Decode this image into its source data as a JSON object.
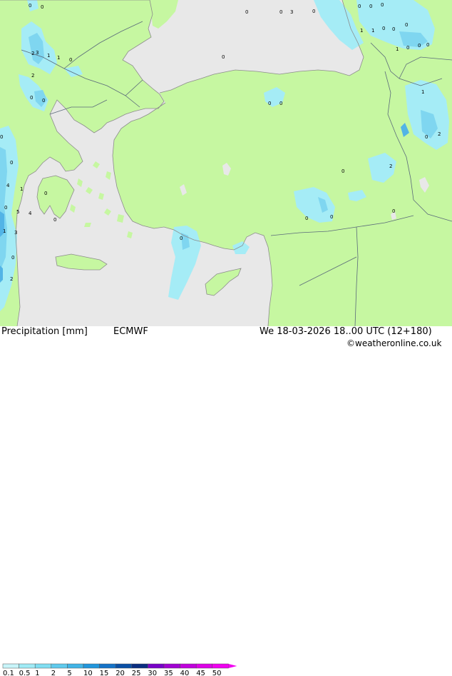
{
  "map": {
    "product_label": "Precipitation [mm]",
    "model": "ECMWF",
    "valid_time": "We 18-03-2026 18..00 UTC (12+180)",
    "copyright": "©weatheronline.co.uk",
    "colors": {
      "sea": "#e8e8e8",
      "land": "#c6f7a1",
      "coast": "#8c8c8c",
      "border": "#5a6a7a",
      "precip_light": "#a5ecf6",
      "precip_medium": "#7fd6f0",
      "precip_heavy": "#52b4e6"
    },
    "legend": {
      "labels": [
        "0.1",
        "0.5",
        "1",
        "2",
        "5",
        "10",
        "15",
        "20",
        "25",
        "30",
        "35",
        "40",
        "45",
        "50"
      ],
      "colors": [
        "#c8f5fa",
        "#a0ebf6",
        "#80def2",
        "#5fcaed",
        "#40b4e6",
        "#2196dc",
        "#1473c8",
        "#0a4fa5",
        "#0a2d80",
        "#7800c8",
        "#a000d2",
        "#c000dc",
        "#dc00e6",
        "#f000f0"
      ]
    },
    "values": [
      {
        "v": "0"
      },
      {
        "v": "0"
      },
      {
        "v": "0"
      },
      {
        "v": "0"
      },
      {
        "v": "3"
      },
      {
        "v": "0"
      },
      {
        "v": "0"
      },
      {
        "v": "0"
      },
      {
        "v": "0"
      },
      {
        "v": "1"
      },
      {
        "v": "1"
      },
      {
        "v": "0"
      },
      {
        "v": "0"
      },
      {
        "v": "0"
      },
      {
        "v": "2"
      },
      {
        "v": "3"
      },
      {
        "v": "1"
      },
      {
        "v": "1"
      },
      {
        "v": "0"
      },
      {
        "v": "2"
      },
      {
        "v": "0"
      },
      {
        "v": "1"
      },
      {
        "v": "0"
      },
      {
        "v": "0"
      },
      {
        "v": "0"
      },
      {
        "v": "0"
      },
      {
        "v": "0"
      },
      {
        "v": "0"
      },
      {
        "v": "0"
      },
      {
        "v": "1"
      },
      {
        "v": "0"
      },
      {
        "v": "2"
      },
      {
        "v": "0"
      },
      {
        "v": "0"
      },
      {
        "v": "2"
      },
      {
        "v": "0"
      },
      {
        "v": "4"
      },
      {
        "v": "1"
      },
      {
        "v": "0"
      },
      {
        "v": "0"
      },
      {
        "v": "5"
      },
      {
        "v": "4"
      },
      {
        "v": "0"
      },
      {
        "v": "0"
      },
      {
        "v": "0"
      },
      {
        "v": "0"
      },
      {
        "v": "1"
      },
      {
        "v": "3"
      },
      {
        "v": "0"
      },
      {
        "v": "2"
      },
      {
        "v": "0"
      }
    ]
  }
}
